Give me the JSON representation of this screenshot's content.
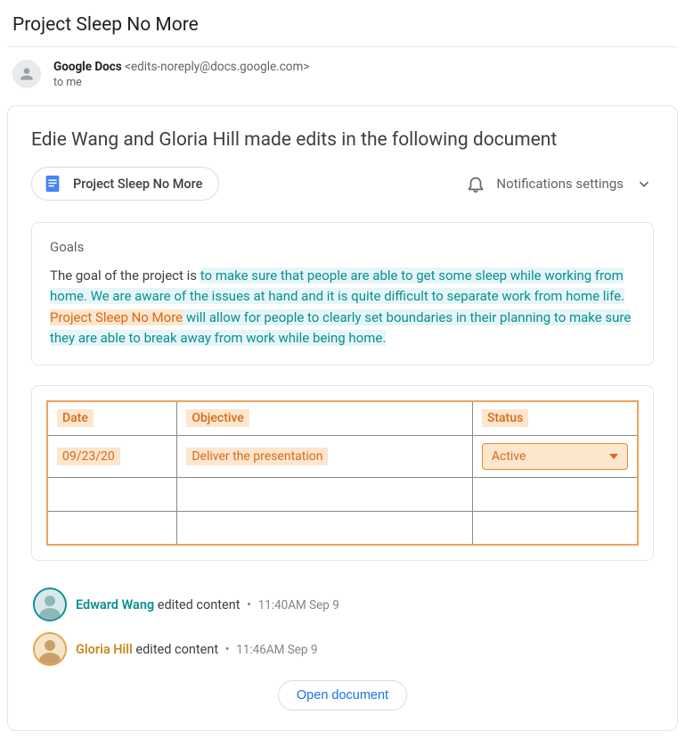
{
  "subject": "Project Sleep No More",
  "sender": {
    "name": "Google Docs",
    "email": "<edits-noreply@docs.google.com>",
    "to": "to me"
  },
  "headline": "Edie Wang and Gloria Hill made edits in the following document",
  "document_chip": "Project Sleep No More",
  "notifications_label": "Notifications settings",
  "goals": {
    "title": "Goals",
    "prefix": "The goal of the project is ",
    "teal1": "to make sure that people are able to get some sleep while working from home. We are aware of the issues at hand and it is quite difficult to separate work from home life. ",
    "orange": "Project Sleep No More",
    "teal2": " will allow for people to clearly set boundaries in their planning to make sure they are able to break away from work while being home."
  },
  "table": {
    "headers": {
      "date": "Date",
      "objective": "Objective",
      "status": "Status"
    },
    "row1": {
      "date": "09/23/20",
      "objective": "Deliver the presentation",
      "status": "Active"
    }
  },
  "editors": [
    {
      "name": "Edward Wang",
      "action": "edited content",
      "ts": "11:40AM Sep 9"
    },
    {
      "name": "Gloria Hill",
      "action": "edited content",
      "ts": "11:46AM Sep 9"
    }
  ],
  "open_button": "Open document"
}
